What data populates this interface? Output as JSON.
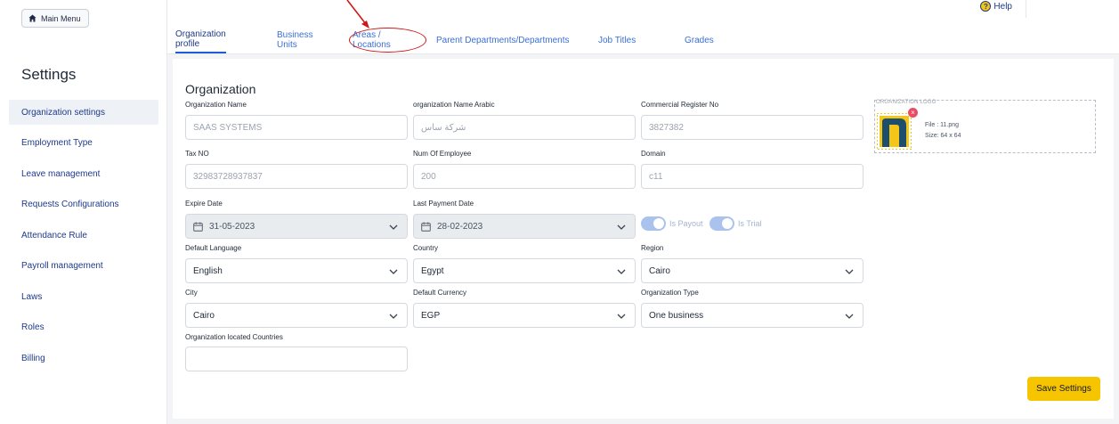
{
  "sidebar": {
    "main_menu_label": "Main Menu",
    "title": "Settings",
    "items": [
      {
        "label": "Organization settings"
      },
      {
        "label": "Employment Type"
      },
      {
        "label": "Leave management"
      },
      {
        "label": "Requests Configurations"
      },
      {
        "label": "Attendance Rule"
      },
      {
        "label": "Payroll management"
      },
      {
        "label": "Laws"
      },
      {
        "label": "Roles"
      },
      {
        "label": "Billing"
      }
    ]
  },
  "header": {
    "help_label": "Help",
    "tabs": [
      {
        "label": "Organization profile"
      },
      {
        "label": "Business Units"
      },
      {
        "label": "Areas / Locations"
      },
      {
        "label": "Parent Departments/Departments"
      },
      {
        "label": "Job Titles"
      },
      {
        "label": "Grades"
      }
    ]
  },
  "form": {
    "title": "Organization",
    "org_name": {
      "label": "Organization Name",
      "value": "SAAS SYSTEMS"
    },
    "org_name_ar": {
      "label": "organization Name Arabic",
      "value": "شركة ساس"
    },
    "commercial_reg": {
      "label": "Commercial Register No",
      "value": "3827382"
    },
    "tax_no": {
      "label": "Tax NO",
      "value": "32983728937837"
    },
    "num_employee": {
      "label": "Num Of Employee",
      "value": "200"
    },
    "domain": {
      "label": "Domain",
      "value": "c11"
    },
    "expire_date": {
      "label": "Expire Date",
      "value": "31-05-2023"
    },
    "last_payment": {
      "label": "Last Payment Date",
      "value": "28-02-2023"
    },
    "is_payout": {
      "label": "Is Payout",
      "enabled": true
    },
    "is_trial": {
      "label": "Is Trial",
      "enabled": true
    },
    "default_language": {
      "label": "Default Language",
      "value": "English"
    },
    "country": {
      "label": "Country",
      "value": "Egypt"
    },
    "region": {
      "label": "Region",
      "value": "Cairo"
    },
    "city": {
      "label": "City",
      "value": "Cairo"
    },
    "default_currency": {
      "label": "Default Currency",
      "value": "EGP"
    },
    "org_type": {
      "label": "Organization Type",
      "value": "One business"
    },
    "located_countries": {
      "label": "Organization located Countries",
      "value": ""
    },
    "logo": {
      "label": "ORGANIZATION LOGO",
      "file": "File : 11.png",
      "size": "Size: 64 x 64"
    },
    "save_label": "Save Settings"
  },
  "colors": {
    "accent": "#1e5bd6",
    "save_button": "#f7c500",
    "annotation": "#d01818"
  }
}
